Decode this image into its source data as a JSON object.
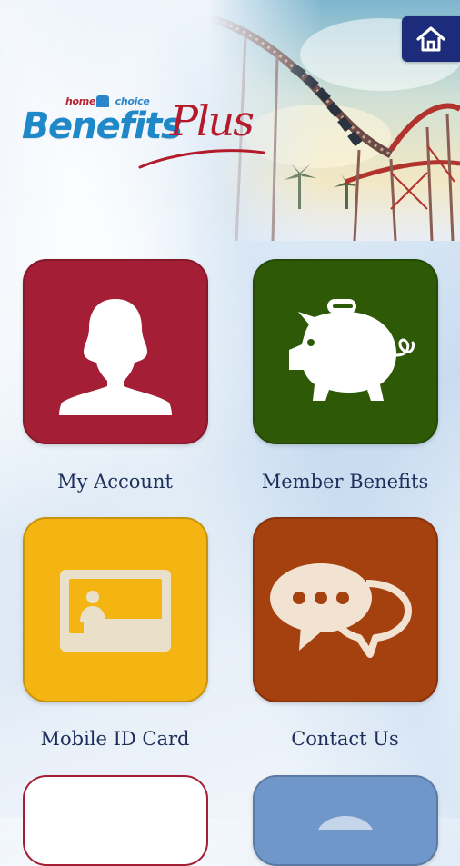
{
  "header": {
    "logo_top_left": "home",
    "logo_top_right": "choice",
    "logo_word_blue": "Benefits",
    "logo_word_red": "Plus",
    "home_button_icon": "home-icon"
  },
  "tiles": [
    {
      "label": "My Account",
      "icon": "person-icon",
      "color": "#a41e36"
    },
    {
      "label": "Member Benefits",
      "icon": "piggy-bank-icon",
      "color": "#2e5a08"
    },
    {
      "label": "Mobile ID Card",
      "icon": "id-card-icon",
      "color": "#f4b512"
    },
    {
      "label": "Contact Us",
      "icon": "chat-bubbles-icon",
      "color": "#a5400f"
    }
  ],
  "colors": {
    "home_button": "#1c2c7a",
    "label_text": "#1e2f5b",
    "logo_blue": "#1f88c9",
    "logo_red": "#b31b2a"
  }
}
